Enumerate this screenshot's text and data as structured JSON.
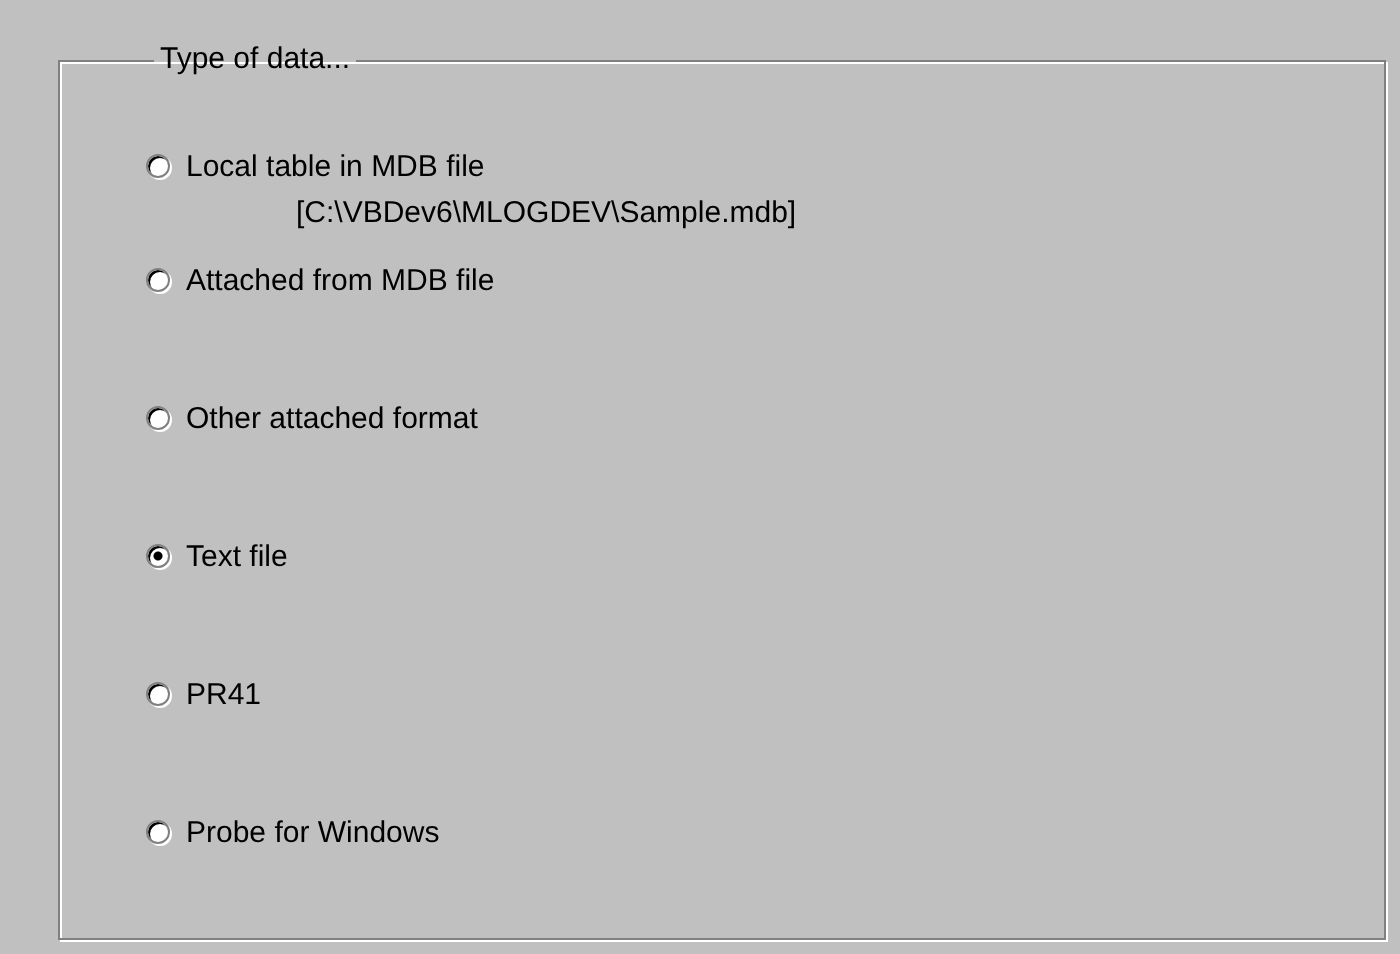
{
  "group": {
    "title": "Type of data...",
    "options": [
      {
        "label": "Local table in MDB file",
        "note": "[C:\\VBDev6\\MLOGDEV\\Sample.mdb]",
        "selected": false
      },
      {
        "label": "Attached from MDB file",
        "selected": false
      },
      {
        "label": "Other attached format",
        "selected": false
      },
      {
        "label": "Text file",
        "selected": true
      },
      {
        "label": "PR41",
        "selected": false
      },
      {
        "label": "Probe for Windows",
        "selected": false
      }
    ]
  }
}
